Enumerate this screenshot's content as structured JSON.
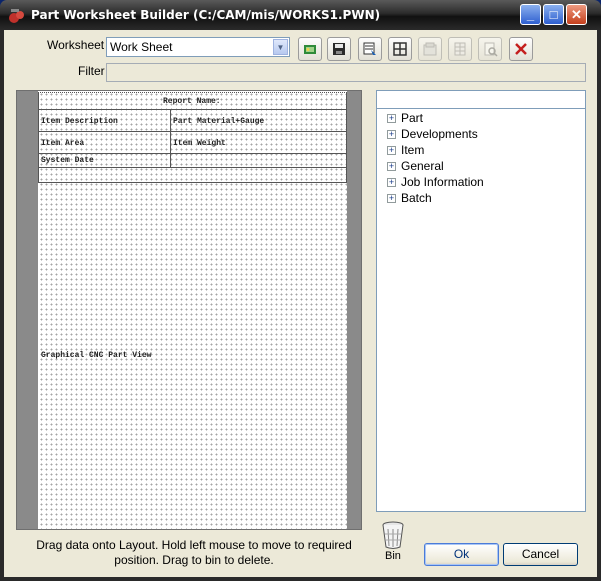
{
  "window": {
    "title": "Part Worksheet Builder (C:/CAM/mis/WORKS1.PWN)",
    "minimize": "_",
    "maximize": "□",
    "close": "✕"
  },
  "form": {
    "worksheet_label": "Worksheet",
    "worksheet_value": "Work Sheet",
    "filter_label": "Filter",
    "filter_value": ""
  },
  "toolbar": {
    "buttons": [
      {
        "icon": "new-sheet-icon",
        "enabled": true
      },
      {
        "icon": "save-icon",
        "enabled": true
      },
      {
        "icon": "select-layout-icon",
        "enabled": true
      },
      {
        "icon": "grid-icon",
        "enabled": true
      },
      {
        "icon": "properties-icon",
        "enabled": false
      },
      {
        "icon": "columns-icon",
        "enabled": false
      },
      {
        "icon": "preview-icon",
        "enabled": false
      },
      {
        "icon": "delete-icon",
        "enabled": true
      }
    ]
  },
  "layout": {
    "report_name": "Report Name:",
    "item_description": "Item Description",
    "part_material_gauge": "Part Material+Gauge",
    "item_area": "Item Area",
    "item_weight": "Item Weight",
    "system_date": "System Date",
    "graphical_view": "Graphical CNC Part View"
  },
  "tree": {
    "items": [
      {
        "label": "Part"
      },
      {
        "label": "Developments"
      },
      {
        "label": "Item"
      },
      {
        "label": "General"
      },
      {
        "label": "Job Information"
      },
      {
        "label": "Batch"
      }
    ],
    "expand_glyph": "+"
  },
  "footer": {
    "hint": "Drag data onto Layout. Hold left mouse to move to required position. Drag to bin to delete.",
    "bin_label": "Bin",
    "ok_label": "Ok",
    "cancel_label": "Cancel"
  }
}
